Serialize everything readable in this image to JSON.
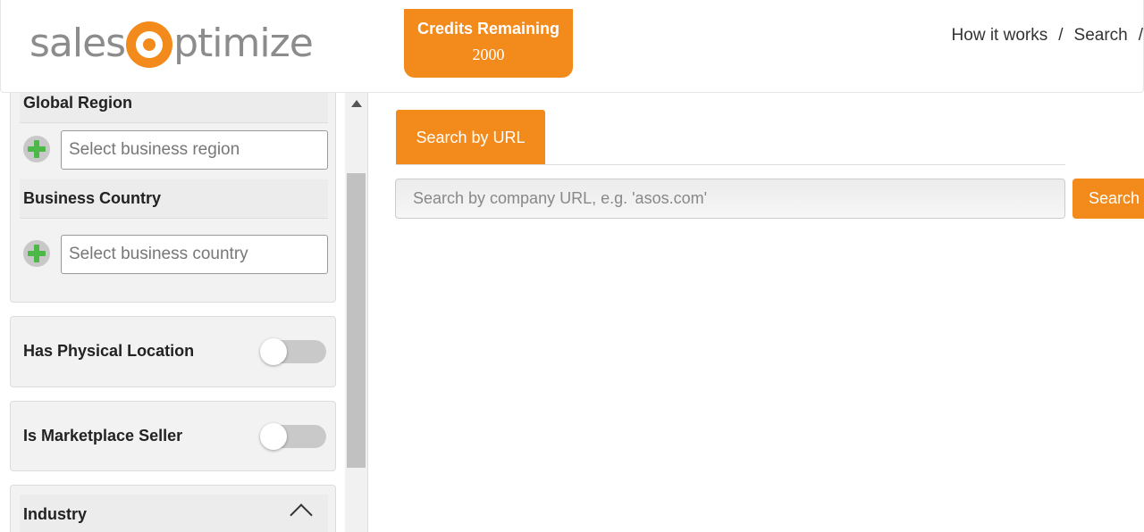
{
  "brand": {
    "logo_pre": "sales",
    "logo_post": "ptimize",
    "accent": "#f28a1c"
  },
  "credits": {
    "title": "Credits Remaining",
    "value": "2000"
  },
  "nav": {
    "items": [
      "How it works",
      "Search"
    ],
    "separator": "/"
  },
  "filters": {
    "global_region": {
      "label": "Global Region",
      "placeholder": "Select business region"
    },
    "business_country": {
      "label": "Business Country",
      "placeholder": "Select business country"
    },
    "has_physical_location": {
      "label": "Has Physical Location",
      "on": false
    },
    "is_marketplace_seller": {
      "label": "Is Marketplace Seller",
      "on": false
    },
    "industry": {
      "label": "Industry"
    }
  },
  "search": {
    "tab_label": "Search by URL",
    "placeholder": "Search by company URL, e.g. 'asos.com'",
    "button_label": "Search"
  }
}
